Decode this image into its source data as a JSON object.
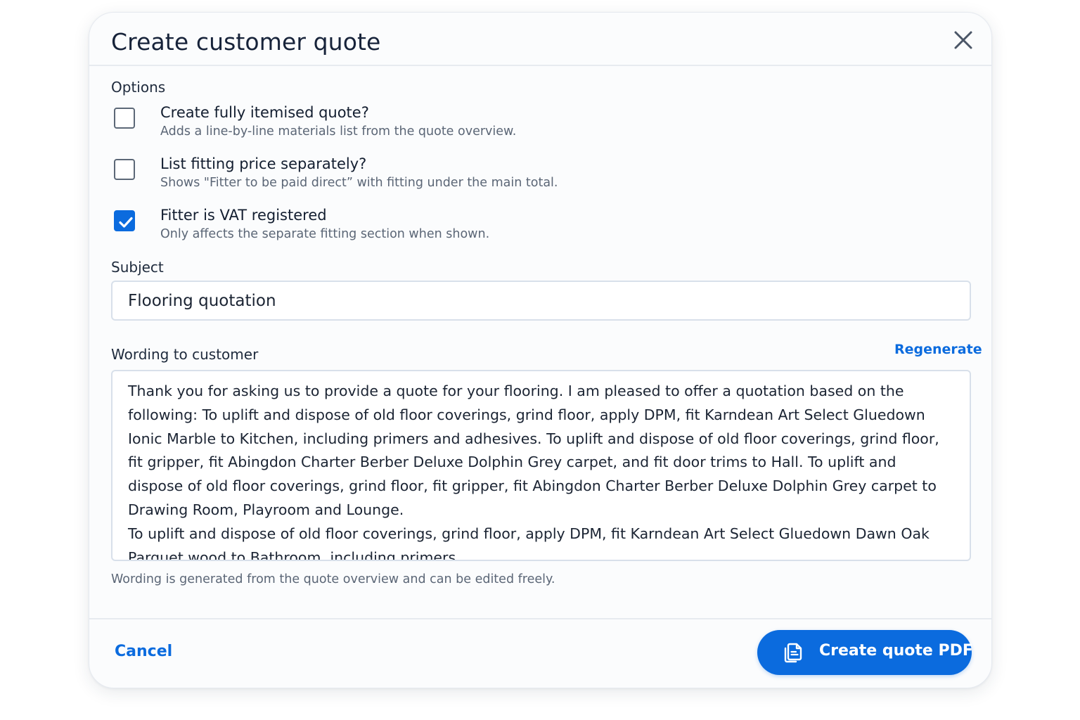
{
  "dialog": {
    "title": "Create customer quote"
  },
  "options": {
    "label": "Options",
    "items": [
      {
        "title": "Create fully itemised quote?",
        "description": "Adds a line-by-line materials list from the quote overview.",
        "checked": false
      },
      {
        "title": "List fitting price separately?",
        "description": "Shows \"Fitter to be paid direct” with fitting under the main total.",
        "checked": false
      },
      {
        "title": "Fitter is VAT registered",
        "description": "Only affects the separate fitting section when shown.",
        "checked": true
      }
    ]
  },
  "subject": {
    "label": "Subject",
    "value": "Flooring quotation"
  },
  "wording": {
    "label": "Wording to customer",
    "regenerate_label": "Regenerate",
    "paragraphs": [
      "Thank you for asking us to provide a quote for your flooring. I am pleased to offer a quotation based on the following: To uplift and dispose of old floor coverings, grind floor, apply DPM, fit Karndean Art Select Gluedown Ionic Marble to Kitchen, including primers and adhesives. To uplift and dispose of old floor coverings, grind floor, fit gripper, fit Abingdon Charter Berber Deluxe Dolphin Grey carpet, and fit door trims to Hall. To uplift and dispose of old floor coverings, grind floor, fit gripper, fit Abingdon Charter Berber Deluxe Dolphin Grey carpet to Drawing Room, Playroom and Lounge.",
      "To uplift and dispose of old floor coverings, grind floor, apply DPM, fit Karndean Art Select Gluedown Dawn Oak Parquet wood to Bathroom, including primers."
    ],
    "hint": "Wording is generated from the quote overview and can be edited freely."
  },
  "footer": {
    "cancel_label": "Cancel",
    "submit_label": "Create quote PDF",
    "submit_icon": "pdf-document-icon"
  },
  "colors": {
    "accent": "#0b6bde",
    "title": "#17233a",
    "muted": "#5b6676",
    "border": "#d8e0ea"
  }
}
